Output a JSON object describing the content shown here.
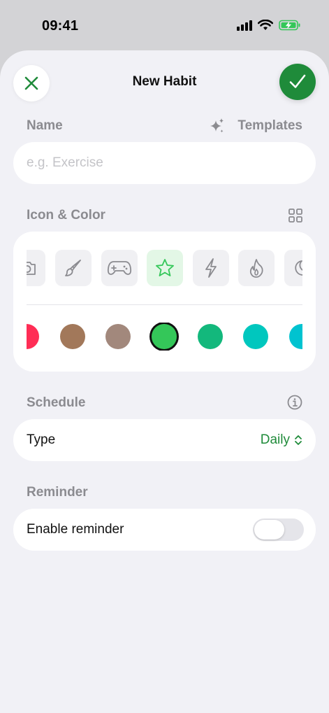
{
  "status_bar": {
    "time": "09:41",
    "icons": [
      "signal-icon",
      "wifi-icon",
      "battery-charging-icon"
    ],
    "battery_color": "#34c759"
  },
  "header": {
    "title": "New Habit",
    "close_icon": "close-icon",
    "confirm_icon": "checkmark-icon",
    "accent_color": "#1f8b3a"
  },
  "name_section": {
    "label": "Name",
    "templates_label": "Templates",
    "templates_icon": "sparkles-icon",
    "input": {
      "placeholder": "e.g. Exercise",
      "value": ""
    }
  },
  "icon_color_section": {
    "label": "Icon & Color",
    "grid_icon": "grid-icon",
    "icons": [
      {
        "name": "camera-icon",
        "selected": false
      },
      {
        "name": "paintbrush-icon",
        "selected": false
      },
      {
        "name": "gamecontroller-icon",
        "selected": false
      },
      {
        "name": "star-icon",
        "selected": true
      },
      {
        "name": "bolt-icon",
        "selected": false
      },
      {
        "name": "flame-icon",
        "selected": false
      },
      {
        "name": "moon-icon",
        "selected": false
      }
    ],
    "colors": [
      {
        "hex": "#ff2d55",
        "selected": false
      },
      {
        "hex": "#a2785a",
        "selected": false
      },
      {
        "hex": "#a2887c",
        "selected": false
      },
      {
        "hex": "#34c759",
        "selected": true
      },
      {
        "hex": "#13b87c",
        "selected": false
      },
      {
        "hex": "#00c7be",
        "selected": false
      },
      {
        "hex": "#00c3d0",
        "selected": false
      }
    ]
  },
  "schedule_section": {
    "label": "Schedule",
    "info_icon": "info-icon",
    "type_label": "Type",
    "type_value": "Daily",
    "type_chevron": "chevron-up-down-icon"
  },
  "reminder_section": {
    "label": "Reminder",
    "enable_label": "Enable reminder",
    "enabled": false
  }
}
